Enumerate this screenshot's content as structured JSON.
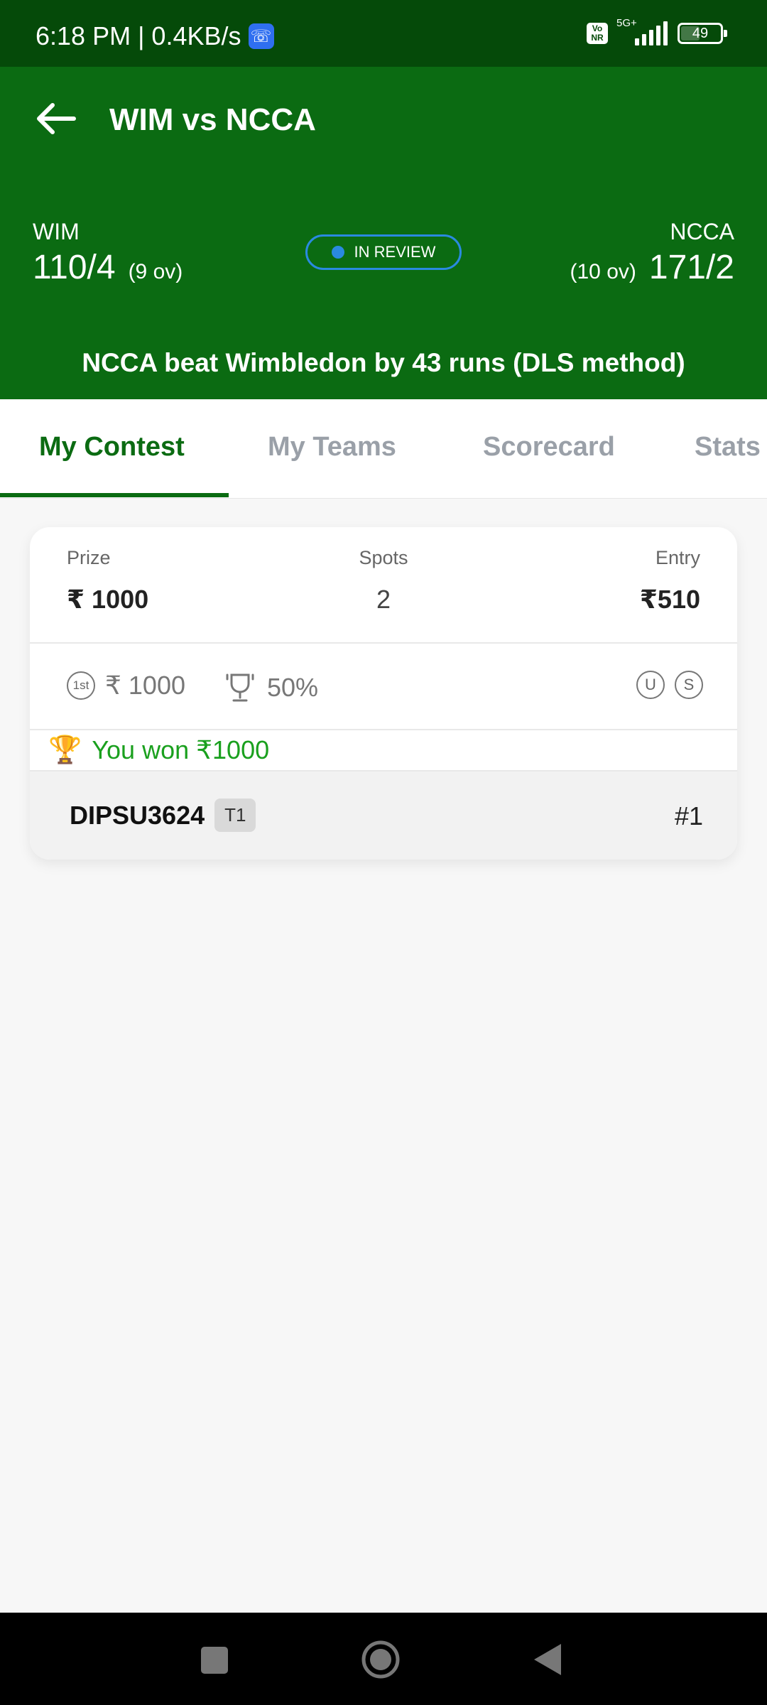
{
  "status_bar": {
    "time_speed": "6:18 PM | 0.4KB/s",
    "network": "5G+",
    "vonr": "Vo NR",
    "battery": "49"
  },
  "header": {
    "title": "WIM vs NCCA",
    "team_a": {
      "name": "WIM",
      "score": "110/4",
      "overs": "(9 ov)"
    },
    "team_b": {
      "name": "NCCA",
      "score": "171/2",
      "overs": "(10 ov)"
    },
    "status": "IN REVIEW",
    "result": "NCCA beat Wimbledon by 43 runs (DLS method)"
  },
  "tabs": [
    {
      "label": "My Contest",
      "active": true
    },
    {
      "label": "My Teams",
      "active": false
    },
    {
      "label": "Scorecard",
      "active": false
    },
    {
      "label": "Stats",
      "active": false
    }
  ],
  "contest": {
    "prize_label": "Prize",
    "prize_value": "₹ 1000",
    "spots_label": "Spots",
    "spots_value": "2",
    "entry_label": "Entry",
    "entry_value": "₹510",
    "first_prize_icon": "1st",
    "first_prize": "₹ 1000",
    "win_percent": "50%",
    "badge_u": "U",
    "badge_s": "S",
    "won_text": "You won ₹1000",
    "team_user": "DIPSU3624",
    "team_tag": "T1",
    "rank": "#1"
  },
  "colors": {
    "status_bar": "#054a09",
    "header": "#0b6b12",
    "accent": "#0b6b12",
    "won_text": "#1aa01e",
    "review": "#2a8ae0"
  }
}
